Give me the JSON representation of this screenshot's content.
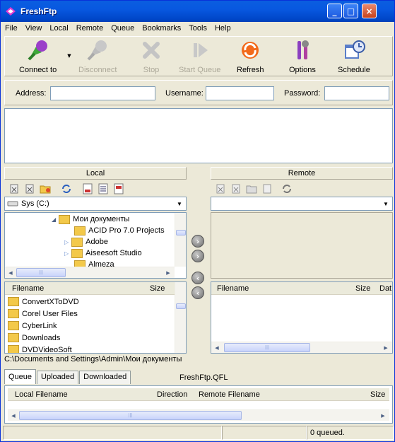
{
  "window": {
    "title": "FreshFtp",
    "minimize": "_",
    "maximize": "□",
    "close": "×"
  },
  "menu": [
    "File",
    "View",
    "Local",
    "Remote",
    "Queue",
    "Bookmarks",
    "Tools",
    "Help"
  ],
  "toolbar": {
    "connect": "Connect to",
    "disconnect": "Disconnect",
    "stop": "Stop",
    "start_queue": "Start Queue",
    "refresh": "Refresh",
    "options": "Options",
    "schedule": "Schedule"
  },
  "connection": {
    "address_label": "Address:",
    "username_label": "Username:",
    "password_label": "Password:",
    "address": "",
    "username": "",
    "password": ""
  },
  "local": {
    "header": "Local",
    "drive": "Sys (C:)",
    "tree": [
      {
        "label": "Мои документы",
        "expanded": true
      },
      {
        "label": "ACID Pro 7.0 Projects"
      },
      {
        "label": "Adobe",
        "expandable": true
      },
      {
        "label": "Aiseesoft Studio",
        "expandable": true
      },
      {
        "label": "Almeza"
      }
    ],
    "col_filename": "Filename",
    "col_size": "Size",
    "files": [
      "ConvertXToDVD",
      "Corel User Files",
      "CyberLink",
      "Downloads",
      "DVDVideoSoft"
    ],
    "path": "C:\\Documents and Settings\\Admin\\Мои документы"
  },
  "remote": {
    "header": "Remote",
    "col_filename": "Filename",
    "col_size": "Size",
    "col_date": "Dat"
  },
  "queue": {
    "tabs": [
      "Queue",
      "Uploaded",
      "Downloaded"
    ],
    "file": "FreshFtp.QFL",
    "col_local": "Local Filename",
    "col_direction": "Direction",
    "col_remote": "Remote Filename",
    "col_size": "Size"
  },
  "status": {
    "queued": "0 queued."
  },
  "colors": {
    "titlebar": "#0058e0",
    "face": "#ece9d8",
    "border": "#7f9db9"
  }
}
